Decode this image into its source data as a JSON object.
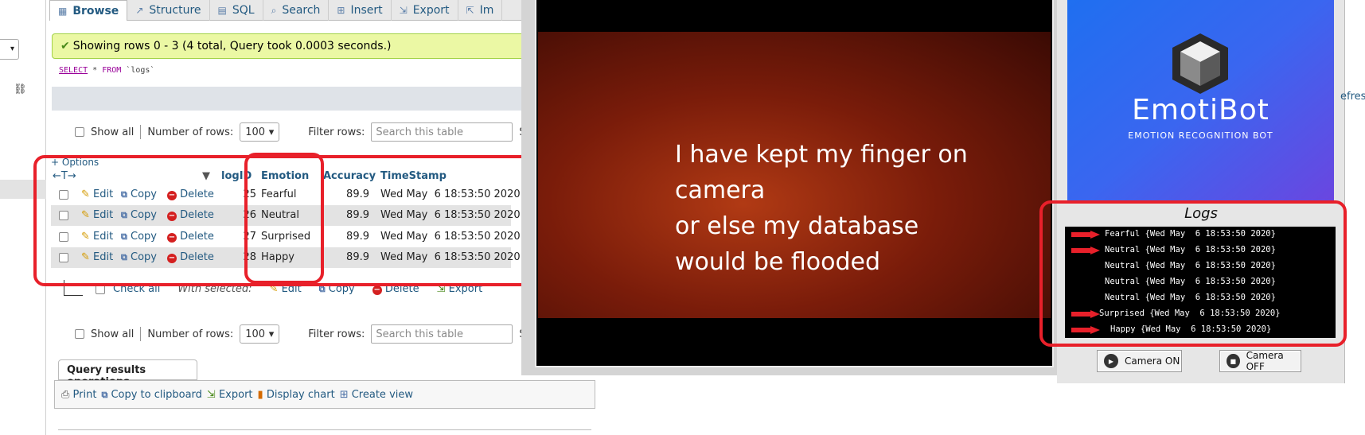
{
  "tabs": [
    {
      "label": "Browse",
      "icon": "browse-icon"
    },
    {
      "label": "Structure",
      "icon": "structure-icon"
    },
    {
      "label": "SQL",
      "icon": "sql-icon"
    },
    {
      "label": "Search",
      "icon": "search-icon"
    },
    {
      "label": "Insert",
      "icon": "insert-icon"
    },
    {
      "label": "Export",
      "icon": "export-icon"
    },
    {
      "label": "Im",
      "icon": "import-icon"
    }
  ],
  "left": {
    "dropdown_glyph": "▾"
  },
  "success_message": "Showing rows 0 - 3 (4 total, Query took 0.0003 seconds.)",
  "sql": {
    "select": "SELECT",
    "star": " * ",
    "from": "FROM",
    "table": " `logs`"
  },
  "controls": {
    "show_all": "Show all",
    "number_of_rows_label": "Number of rows:",
    "rows_value": "100",
    "filter_label": "Filter rows:",
    "filter_placeholder": "Search this table",
    "cut_text": "So"
  },
  "table": {
    "options": "+ Options",
    "arrows": "←T→",
    "columns": [
      "logID",
      "Emotion",
      "Accuracy",
      "TimeStamp"
    ],
    "edit": "Edit",
    "copy": "Copy",
    "delete": "Delete",
    "rows": [
      {
        "logID": "25",
        "emotion": "Fearful",
        "accuracy": "89.9",
        "timestamp": "Wed May  6 18:53:50 2020"
      },
      {
        "logID": "26",
        "emotion": "Neutral",
        "accuracy": "89.9",
        "timestamp": "Wed May  6 18:53:50 2020"
      },
      {
        "logID": "27",
        "emotion": "Surprised",
        "accuracy": "89.9",
        "timestamp": "Wed May  6 18:53:50 2020"
      },
      {
        "logID": "28",
        "emotion": "Happy",
        "accuracy": "89.9",
        "timestamp": "Wed May  6 18:53:50 2020"
      }
    ]
  },
  "bulk": {
    "check_all": "Check all",
    "with_selected": "With selected:",
    "edit": "Edit",
    "copy": "Copy",
    "delete": "Delete",
    "export": "Export"
  },
  "query_ops": {
    "title": "Query results operations",
    "print": "Print",
    "copy_clipboard": "Copy to clipboard",
    "export": "Export",
    "display_chart": "Display chart",
    "create_view": "Create view"
  },
  "video": {
    "lines": [
      "I have kept my finger on",
      "camera",
      "or else my database",
      "would be flooded"
    ]
  },
  "emotibot": {
    "name": "EmotiBot",
    "subtitle": "EMOTION RECOGNITION BOT",
    "logs_title": "Logs",
    "log_lines": [
      "Fearful {Wed May  6 18:53:50 2020}",
      "Neutral {Wed May  6 18:53:50 2020}",
      "Neutral {Wed May  6 18:53:50 2020}",
      "Neutral {Wed May  6 18:53:50 2020}",
      "Neutral {Wed May  6 18:53:50 2020}",
      "Surprised {Wed May  6 18:53:50 2020}",
      "Happy {Wed May  6 18:53:50 2020}"
    ],
    "camera_on": "Camera ON",
    "camera_off": "Camera OFF"
  },
  "refresh_cut": "efres",
  "colors": {
    "annotation_red": "#e8202a",
    "success_bg": "#ebf8a4",
    "link_blue": "#235a81"
  }
}
